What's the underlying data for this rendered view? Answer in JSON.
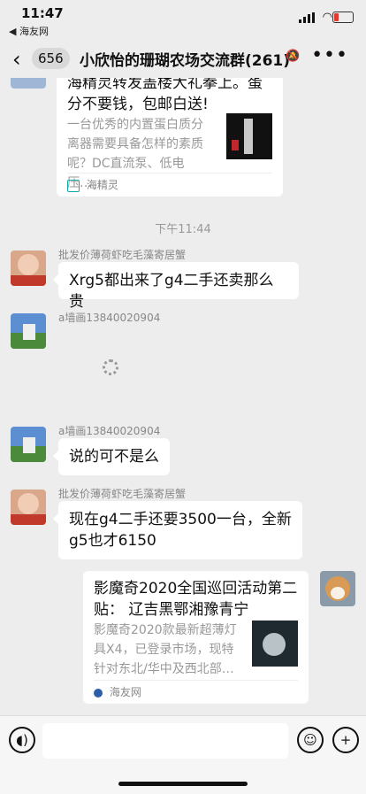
{
  "status": {
    "time": "11:47",
    "back_app": "◀ 海友网"
  },
  "header": {
    "unread_count": "656",
    "title": "小欣怡的珊瑚农场交流群(261)"
  },
  "chat": {
    "card1": {
      "title_partial": "海精灵转发盖楼大礼拳上。蛋分不要钱，包邮白送!",
      "desc": "一台优秀的内置蛋白质分离器需要具备怎样的素质呢？DC直流泵、低电压…",
      "source": "海精灵"
    },
    "timestamp": "下午11:44",
    "msg1": {
      "nick": "批发价薄荷虾吃毛藻寄居蟹",
      "text": "Xrg5都出来了g4二手还卖那么贵"
    },
    "msg2": {
      "nick": "a墙画13840020904"
    },
    "msg3": {
      "nick": "a墙画13840020904",
      "text": "说的可不是么"
    },
    "msg4": {
      "nick": "批发价薄荷虾吃毛藻寄居蟹",
      "text": "现在g4二手还要3500一台，全新g5也才6150"
    },
    "card2": {
      "title": "影魔奇2020全国巡回活动第二贴： 辽吉黑鄂湘豫青宁",
      "desc": "影魔奇2020款最新超薄灯具X4，已登录市场，现特针对东北/华中及西北部…",
      "source": "海友网"
    }
  },
  "icons": {
    "back": "chevron-left-icon",
    "more": "more-icon",
    "voice": "voice-icon",
    "emoji": "emoji-icon",
    "plus": "plus-icon"
  }
}
